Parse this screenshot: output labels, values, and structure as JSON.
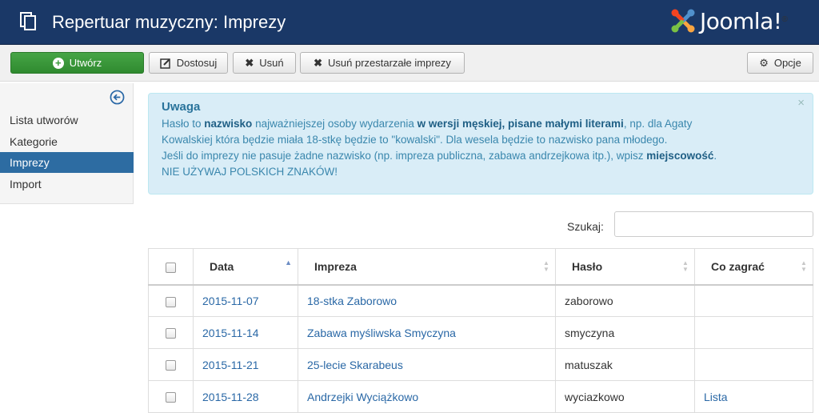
{
  "header": {
    "title": "Repertuar muzyczny: Imprezy",
    "brand": "Joomla!",
    "brand_color": "#1a3867"
  },
  "toolbar": {
    "new_label": "Utwórz",
    "edit_label": "Dostosuj",
    "delete_label": "Usuń",
    "delete_old_label": "Usuń przestarzałe imprezy",
    "options_label": "Opcje"
  },
  "sidebar": {
    "items": [
      {
        "label": "Lista utworów",
        "active": false
      },
      {
        "label": "Kategorie",
        "active": false
      },
      {
        "label": "Imprezy",
        "active": true
      },
      {
        "label": "Import",
        "active": false
      }
    ],
    "active_color": "#2d6ca2"
  },
  "alert": {
    "heading": "Uwaga",
    "close_glyph": "×",
    "line1_a": "Hasło to ",
    "line1_b": "nazwisko",
    "line1_c": " najważniejszej osoby wydarzenia ",
    "line1_d": "w wersji męskiej, pisane małymi literami",
    "line1_e": ", np. dla Agaty",
    "line2": "Kowalskiej która będzie miała 18-stkę będzie to \"kowalski\". Dla wesela będzie to nazwisko pana młodego.",
    "line3_a": "Jeśli do imprezy nie pasuje żadne nazwisko (np. impreza publiczna, zabawa andrzejkowa itp.), wpisz ",
    "line3_b": "miejscowość",
    "line3_c": ".",
    "line4": "NIE UŻYWAJ POLSKICH ZNAKÓW!"
  },
  "search": {
    "label": "Szukaj:",
    "value": ""
  },
  "table": {
    "headers": {
      "date": "Data",
      "event": "Impreza",
      "password": "Hasło",
      "what_to_play": "Co zagrać"
    },
    "rows": [
      {
        "date": "2015-11-07",
        "event": "18-stka Zaborowo",
        "password": "zaborowo",
        "what_to_play": ""
      },
      {
        "date": "2015-11-14",
        "event": "Zabawa myśliwska Smyczyna",
        "password": "smyczyna",
        "what_to_play": ""
      },
      {
        "date": "2015-11-21",
        "event": "25-lecie Skarabeus",
        "password": "matuszak",
        "what_to_play": ""
      },
      {
        "date": "2015-11-28",
        "event": "Andrzejki Wyciążkowo",
        "password": "wyciazkowo",
        "what_to_play": "Lista"
      }
    ]
  },
  "colors": {
    "new_button": "#46a546",
    "link": "#2a68a6",
    "alert_bg": "#d9edf7"
  }
}
